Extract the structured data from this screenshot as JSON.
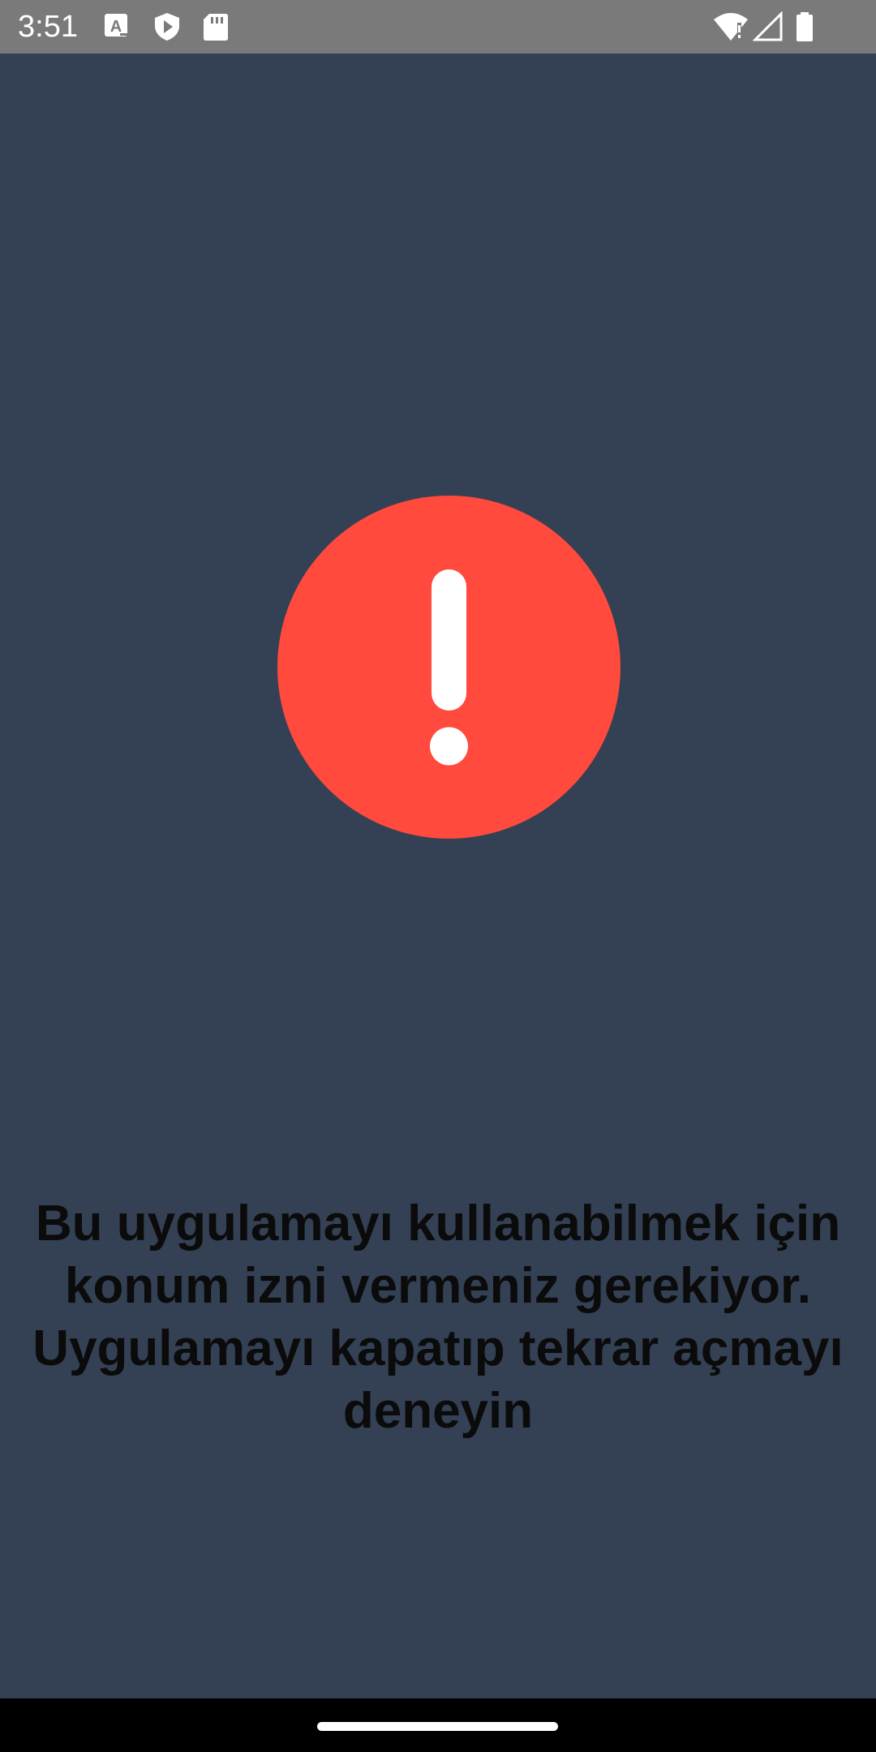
{
  "status_bar": {
    "time": "3:51",
    "left_icons": [
      "font-a-icon",
      "shield-play-icon",
      "sd-card-icon"
    ],
    "right_icons": [
      "wifi-alert-icon",
      "cell-signal-icon",
      "battery-icon"
    ]
  },
  "alert": {
    "icon": "exclamation-circle-icon",
    "color": "#ff4a3d"
  },
  "message": {
    "line1": "Bu uygulamayı kullanabilmek için",
    "line2": "konum izni vermeniz gerekiyor.",
    "line3": "Uygulamayı kapatıp tekrar açmayı",
    "line4": "deneyin"
  },
  "colors": {
    "background": "#344154",
    "status_bar": "#7a7a7a",
    "text": "#0b0b0b",
    "nav_bar": "#000000"
  }
}
